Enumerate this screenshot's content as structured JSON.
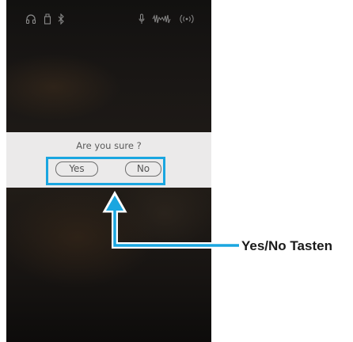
{
  "status_bar": {
    "icons": [
      "headphones-icon",
      "usb-drive-icon",
      "bluetooth-icon",
      "microphone-icon",
      "audio-waveform-icon",
      "wireless-signal-icon"
    ]
  },
  "dialog": {
    "message": "Are you sure ?",
    "yes_label": "Yes",
    "no_label": "No"
  },
  "annotation": {
    "label": "Yes/No Tasten",
    "color": "#1aa6e0"
  }
}
